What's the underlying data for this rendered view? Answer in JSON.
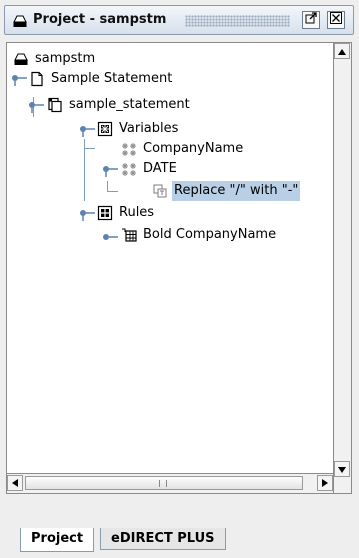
{
  "window": {
    "title": "Project - sampstm"
  },
  "tree": {
    "nodes": [
      {
        "label": "sampstm",
        "icon": "project-icon"
      },
      {
        "label": "Sample Statement",
        "icon": "document-icon"
      },
      {
        "label": "sample_statement",
        "icon": "statement-icon"
      },
      {
        "label": "Variables",
        "icon": "variables-folder-icon"
      },
      {
        "label": "CompanyName",
        "icon": "variable-icon"
      },
      {
        "label": "DATE",
        "icon": "variable-icon"
      },
      {
        "label": "Replace \"/\" with \"-\"",
        "icon": "transform-icon",
        "selected": true
      },
      {
        "label": "Rules",
        "icon": "rules-folder-icon"
      },
      {
        "label": "Bold CompanyName",
        "icon": "rule-icon"
      }
    ]
  },
  "tabs": [
    {
      "label": "Project",
      "active": true
    },
    {
      "label": "eDIRECT PLUS",
      "active": false
    }
  ],
  "colors": {
    "selection": "#b8cfe5",
    "tree_lines": "#7d9cbf",
    "titlebar": "#d6e0ec"
  }
}
